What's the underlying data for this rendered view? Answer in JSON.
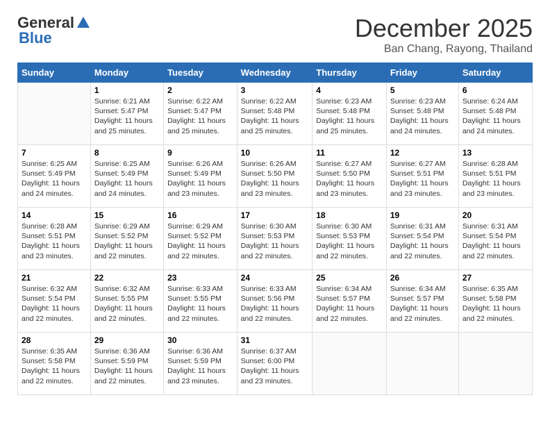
{
  "logo": {
    "line1": "General",
    "line2": "Blue"
  },
  "title": "December 2025",
  "location": "Ban Chang, Rayong, Thailand",
  "weekdays": [
    "Sunday",
    "Monday",
    "Tuesday",
    "Wednesday",
    "Thursday",
    "Friday",
    "Saturday"
  ],
  "weeks": [
    [
      {
        "day": "",
        "info": ""
      },
      {
        "day": "1",
        "info": "Sunrise: 6:21 AM\nSunset: 5:47 PM\nDaylight: 11 hours\nand 25 minutes."
      },
      {
        "day": "2",
        "info": "Sunrise: 6:22 AM\nSunset: 5:47 PM\nDaylight: 11 hours\nand 25 minutes."
      },
      {
        "day": "3",
        "info": "Sunrise: 6:22 AM\nSunset: 5:48 PM\nDaylight: 11 hours\nand 25 minutes."
      },
      {
        "day": "4",
        "info": "Sunrise: 6:23 AM\nSunset: 5:48 PM\nDaylight: 11 hours\nand 25 minutes."
      },
      {
        "day": "5",
        "info": "Sunrise: 6:23 AM\nSunset: 5:48 PM\nDaylight: 11 hours\nand 24 minutes."
      },
      {
        "day": "6",
        "info": "Sunrise: 6:24 AM\nSunset: 5:48 PM\nDaylight: 11 hours\nand 24 minutes."
      }
    ],
    [
      {
        "day": "7",
        "info": "Sunrise: 6:25 AM\nSunset: 5:49 PM\nDaylight: 11 hours\nand 24 minutes."
      },
      {
        "day": "8",
        "info": "Sunrise: 6:25 AM\nSunset: 5:49 PM\nDaylight: 11 hours\nand 24 minutes."
      },
      {
        "day": "9",
        "info": "Sunrise: 6:26 AM\nSunset: 5:49 PM\nDaylight: 11 hours\nand 23 minutes."
      },
      {
        "day": "10",
        "info": "Sunrise: 6:26 AM\nSunset: 5:50 PM\nDaylight: 11 hours\nand 23 minutes."
      },
      {
        "day": "11",
        "info": "Sunrise: 6:27 AM\nSunset: 5:50 PM\nDaylight: 11 hours\nand 23 minutes."
      },
      {
        "day": "12",
        "info": "Sunrise: 6:27 AM\nSunset: 5:51 PM\nDaylight: 11 hours\nand 23 minutes."
      },
      {
        "day": "13",
        "info": "Sunrise: 6:28 AM\nSunset: 5:51 PM\nDaylight: 11 hours\nand 23 minutes."
      }
    ],
    [
      {
        "day": "14",
        "info": "Sunrise: 6:28 AM\nSunset: 5:51 PM\nDaylight: 11 hours\nand 23 minutes."
      },
      {
        "day": "15",
        "info": "Sunrise: 6:29 AM\nSunset: 5:52 PM\nDaylight: 11 hours\nand 22 minutes."
      },
      {
        "day": "16",
        "info": "Sunrise: 6:29 AM\nSunset: 5:52 PM\nDaylight: 11 hours\nand 22 minutes."
      },
      {
        "day": "17",
        "info": "Sunrise: 6:30 AM\nSunset: 5:53 PM\nDaylight: 11 hours\nand 22 minutes."
      },
      {
        "day": "18",
        "info": "Sunrise: 6:30 AM\nSunset: 5:53 PM\nDaylight: 11 hours\nand 22 minutes."
      },
      {
        "day": "19",
        "info": "Sunrise: 6:31 AM\nSunset: 5:54 PM\nDaylight: 11 hours\nand 22 minutes."
      },
      {
        "day": "20",
        "info": "Sunrise: 6:31 AM\nSunset: 5:54 PM\nDaylight: 11 hours\nand 22 minutes."
      }
    ],
    [
      {
        "day": "21",
        "info": "Sunrise: 6:32 AM\nSunset: 5:54 PM\nDaylight: 11 hours\nand 22 minutes."
      },
      {
        "day": "22",
        "info": "Sunrise: 6:32 AM\nSunset: 5:55 PM\nDaylight: 11 hours\nand 22 minutes."
      },
      {
        "day": "23",
        "info": "Sunrise: 6:33 AM\nSunset: 5:55 PM\nDaylight: 11 hours\nand 22 minutes."
      },
      {
        "day": "24",
        "info": "Sunrise: 6:33 AM\nSunset: 5:56 PM\nDaylight: 11 hours\nand 22 minutes."
      },
      {
        "day": "25",
        "info": "Sunrise: 6:34 AM\nSunset: 5:57 PM\nDaylight: 11 hours\nand 22 minutes."
      },
      {
        "day": "26",
        "info": "Sunrise: 6:34 AM\nSunset: 5:57 PM\nDaylight: 11 hours\nand 22 minutes."
      },
      {
        "day": "27",
        "info": "Sunrise: 6:35 AM\nSunset: 5:58 PM\nDaylight: 11 hours\nand 22 minutes."
      }
    ],
    [
      {
        "day": "28",
        "info": "Sunrise: 6:35 AM\nSunset: 5:58 PM\nDaylight: 11 hours\nand 22 minutes."
      },
      {
        "day": "29",
        "info": "Sunrise: 6:36 AM\nSunset: 5:59 PM\nDaylight: 11 hours\nand 22 minutes."
      },
      {
        "day": "30",
        "info": "Sunrise: 6:36 AM\nSunset: 5:59 PM\nDaylight: 11 hours\nand 23 minutes."
      },
      {
        "day": "31",
        "info": "Sunrise: 6:37 AM\nSunset: 6:00 PM\nDaylight: 11 hours\nand 23 minutes."
      },
      {
        "day": "",
        "info": ""
      },
      {
        "day": "",
        "info": ""
      },
      {
        "day": "",
        "info": ""
      }
    ]
  ]
}
